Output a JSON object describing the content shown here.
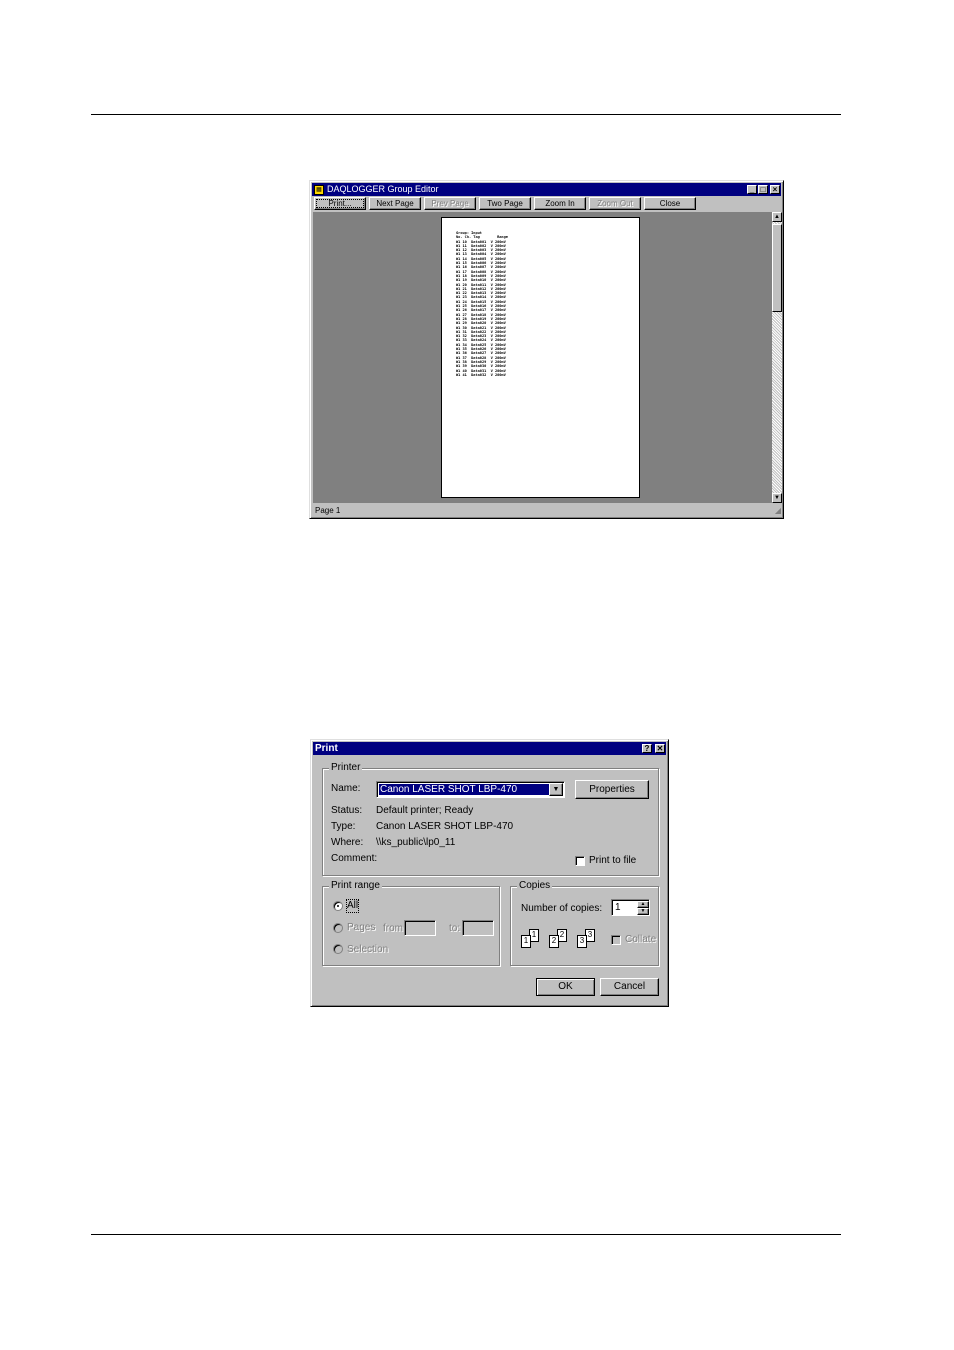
{
  "preview": {
    "title": "DAQLOGGER Group Editor",
    "toolbar": [
      "Print...",
      "Next Page",
      "Prev Page",
      "Two Page",
      "Zoom In",
      "Zoom Out",
      "Close"
    ],
    "status": "Page 1"
  },
  "print_dialog": {
    "title": "Print",
    "help": "?",
    "close": "✕",
    "printer_group": "Printer",
    "name_label": "Name:",
    "name_value": "Canon LASER SHOT LBP-470",
    "properties": "Properties",
    "status_label": "Status:",
    "status_value": "Default printer; Ready",
    "type_label": "Type:",
    "type_value": "Canon LASER SHOT LBP-470",
    "where_label": "Where:",
    "where_value": "\\\\ks_public\\lp0_11",
    "comment_label": "Comment:",
    "print_to_file": "Print to file",
    "range_group": "Print range",
    "all": "All",
    "pages": "Pages",
    "from": "from:",
    "to": "to:",
    "selection": "Selection",
    "copies_group": "Copies",
    "num_copies_label": "Number of copies:",
    "num_copies_value": "1",
    "collate": "Collate",
    "ok": "OK",
    "cancel": "Cancel"
  },
  "colors": {
    "titlebar": "#000080",
    "face": "#c0c0c0",
    "workspace": "#808080"
  },
  "icons": [
    "app-icon",
    "minimize-icon",
    "maximize-icon",
    "close-icon",
    "help-icon",
    "dropdown-arrow-icon",
    "spin-up-icon",
    "spin-down-icon",
    "collate-pages-icon"
  ]
}
